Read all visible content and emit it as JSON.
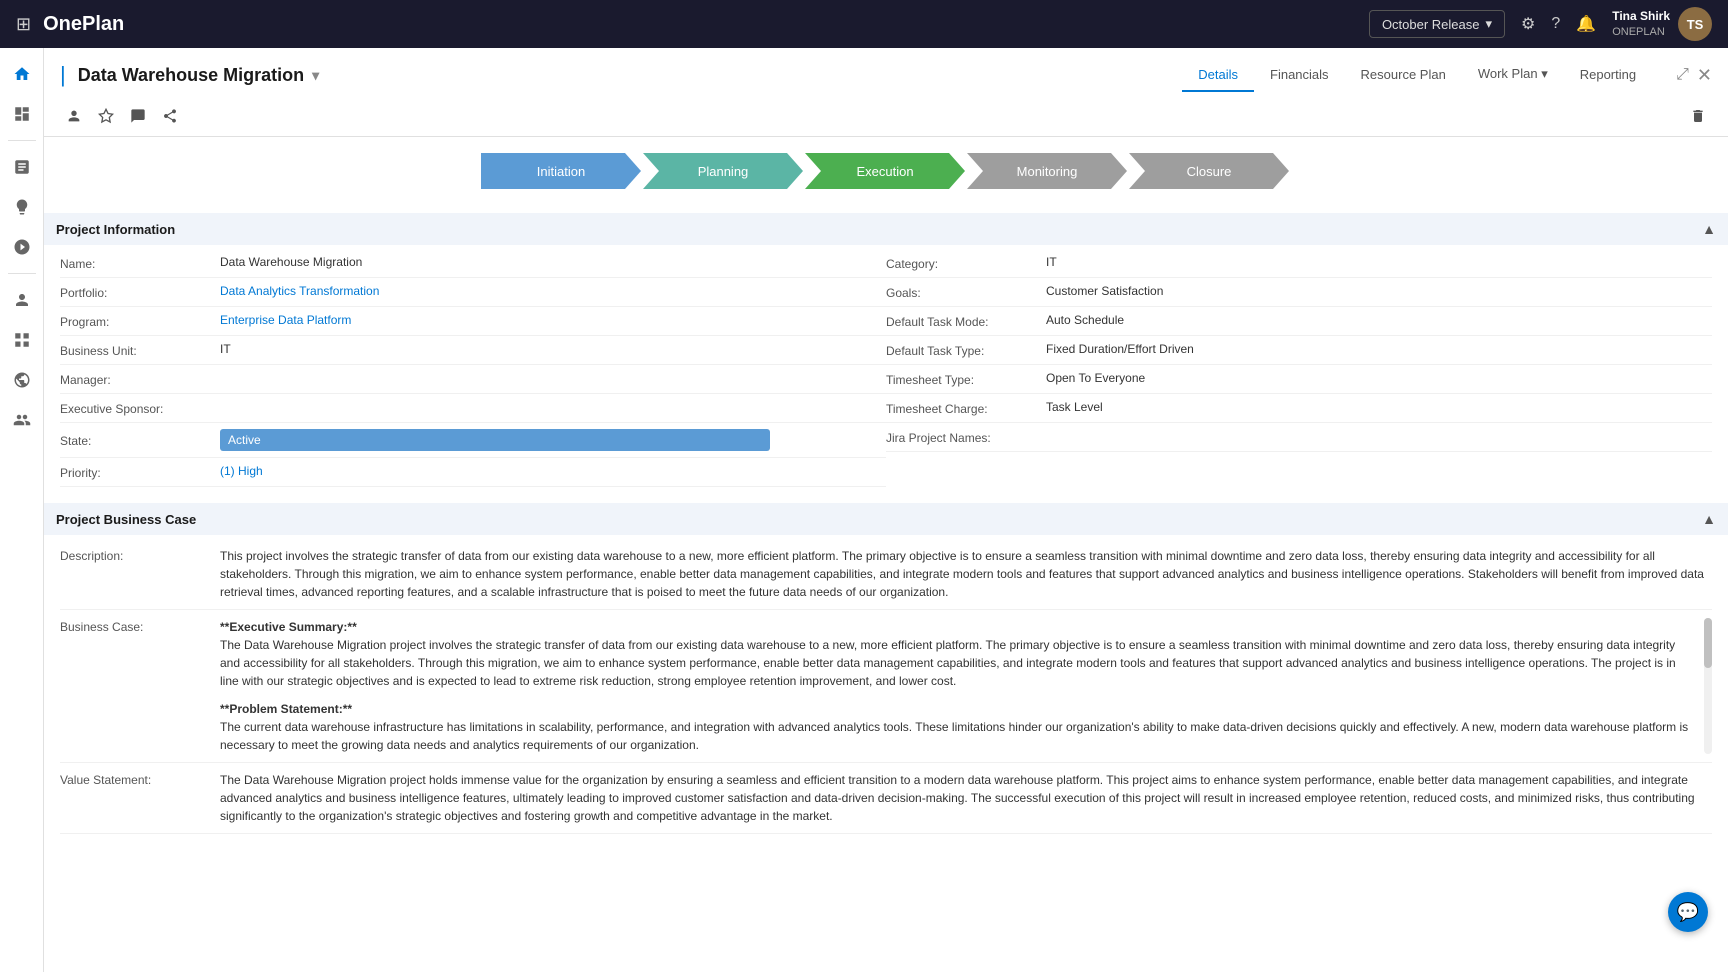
{
  "app": {
    "name": "OnePlan",
    "grid_icon": "⊞"
  },
  "top_bar": {
    "release": "October Release",
    "release_dropdown": "▾",
    "user": {
      "name": "Tina Shirk",
      "org": "ONEPLAN",
      "initials": "TS"
    }
  },
  "nav_tabs": [
    {
      "id": "details",
      "label": "Details",
      "active": true
    },
    {
      "id": "financials",
      "label": "Financials",
      "active": false
    },
    {
      "id": "resource-plan",
      "label": "Resource Plan",
      "active": false
    },
    {
      "id": "work-plan",
      "label": "Work Plan",
      "active": false,
      "has_dropdown": true
    },
    {
      "id": "reporting",
      "label": "Reporting",
      "active": false
    }
  ],
  "project_title": "Data Warehouse Migration",
  "toolbar": {
    "icons": [
      "👤",
      "☆",
      "💬",
      "↗"
    ]
  },
  "stages": [
    {
      "id": "initiation",
      "label": "Initiation",
      "style": "blue"
    },
    {
      "id": "planning",
      "label": "Planning",
      "style": "teal"
    },
    {
      "id": "execution",
      "label": "Execution",
      "style": "green"
    },
    {
      "id": "monitoring",
      "label": "Monitoring",
      "style": "gray"
    },
    {
      "id": "closure",
      "label": "Closure",
      "style": "gray"
    }
  ],
  "project_information": {
    "section_title": "Project Information",
    "fields_left": [
      {
        "id": "name",
        "label": "Name:",
        "value": "Data Warehouse Migration",
        "type": "text"
      },
      {
        "id": "portfolio",
        "label": "Portfolio:",
        "value": "Data Analytics Transformation",
        "type": "link"
      },
      {
        "id": "program",
        "label": "Program:",
        "value": "Enterprise Data Platform",
        "type": "link"
      },
      {
        "id": "business-unit",
        "label": "Business Unit:",
        "value": "IT",
        "type": "text"
      },
      {
        "id": "manager",
        "label": "Manager:",
        "value": "",
        "type": "text"
      },
      {
        "id": "executive-sponsor",
        "label": "Executive Sponsor:",
        "value": "",
        "type": "text"
      },
      {
        "id": "state",
        "label": "State:",
        "value": "Active",
        "type": "badge"
      },
      {
        "id": "priority",
        "label": "Priority:",
        "value": "(1) High",
        "type": "priority"
      }
    ],
    "fields_right": [
      {
        "id": "category",
        "label": "Category:",
        "value": "IT",
        "type": "text"
      },
      {
        "id": "goals",
        "label": "Goals:",
        "value": "Customer Satisfaction",
        "type": "text"
      },
      {
        "id": "default-task-mode",
        "label": "Default Task Mode:",
        "value": "Auto Schedule",
        "type": "text"
      },
      {
        "id": "default-task-type",
        "label": "Default Task Type:",
        "value": "Fixed Duration/Effort Driven",
        "type": "text"
      },
      {
        "id": "timesheet-type",
        "label": "Timesheet Type:",
        "value": "Open To Everyone",
        "type": "text"
      },
      {
        "id": "timesheet-charge",
        "label": "Timesheet Charge:",
        "value": "Task Level",
        "type": "text"
      },
      {
        "id": "jira-project-names",
        "label": "Jira Project Names:",
        "value": "",
        "type": "text"
      }
    ]
  },
  "project_business_case": {
    "section_title": "Project Business Case",
    "description_label": "Description:",
    "description_value": "This project involves the strategic transfer of data from our existing data warehouse to a new, more efficient platform. The primary objective is to ensure a seamless transition with minimal downtime and zero data loss, thereby ensuring data integrity and accessibility for all stakeholders. Through this migration, we aim to enhance system performance, enable better data management capabilities, and integrate modern tools and features that support advanced analytics and business intelligence operations. Stakeholders will benefit from improved data retrieval times, advanced reporting features, and a scalable infrastructure that is poised to meet the future data needs of our organization.",
    "business_case_label": "Business Case:",
    "business_case_heading": "**Executive Summary:**",
    "business_case_text": "The Data Warehouse Migration project involves the strategic transfer of data from our existing data warehouse to a new, more efficient platform. The primary objective is to ensure a seamless transition with minimal downtime and zero data loss, thereby ensuring data integrity and accessibility for all stakeholders. Through this migration, we aim to enhance system performance, enable better data management capabilities, and integrate modern tools and features that support advanced analytics and business intelligence operations. The project is in line with our strategic objectives and is expected to lead to extreme risk reduction, strong employee retention improvement, and lower cost.",
    "problem_statement_heading": "**Problem Statement:**",
    "problem_statement_text": "The current data warehouse infrastructure has limitations in scalability, performance, and integration with advanced analytics tools. These limitations hinder our organization's ability to make data-driven decisions quickly and effectively. A new, modern data warehouse platform is necessary to meet the growing data needs and analytics requirements of our organization.",
    "value_statement_label": "Value Statement:",
    "value_statement_text": "The Data Warehouse Migration project holds immense value for the organization by ensuring a seamless and efficient transition to a modern data warehouse platform. This project aims to enhance system performance, enable better data management capabilities, and integrate advanced analytics and business intelligence features, ultimately leading to improved customer satisfaction and data-driven decision-making. The successful execution of this project will result in increased employee retention, reduced costs, and minimized risks, thus contributing significantly to the organization's strategic objectives and fostering growth and competitive advantage in the market."
  },
  "sidebar_icons": [
    {
      "id": "home",
      "icon": "⌂",
      "label": "home-icon"
    },
    {
      "id": "pages",
      "icon": "☰",
      "label": "pages-icon"
    },
    {
      "id": "chart",
      "icon": "📊",
      "label": "chart-icon"
    },
    {
      "id": "lightbulb",
      "icon": "💡",
      "label": "lightbulb-icon"
    },
    {
      "id": "map",
      "icon": "◉",
      "label": "map-icon"
    },
    {
      "id": "person",
      "icon": "👤",
      "label": "person-icon"
    },
    {
      "id": "grid2",
      "icon": "⊞",
      "label": "grid2-icon"
    },
    {
      "id": "world",
      "icon": "🌐",
      "label": "world-icon"
    },
    {
      "id": "person2",
      "icon": "👤",
      "label": "person2-icon"
    }
  ],
  "colors": {
    "active_blue": "#0078d4",
    "stage_blue": "#5b9bd5",
    "stage_teal": "#5bb5a5",
    "stage_green": "#4caf50",
    "stage_gray": "#9e9e9e",
    "header_dark": "#1a1a2e",
    "section_bg": "#f0f4fa"
  }
}
